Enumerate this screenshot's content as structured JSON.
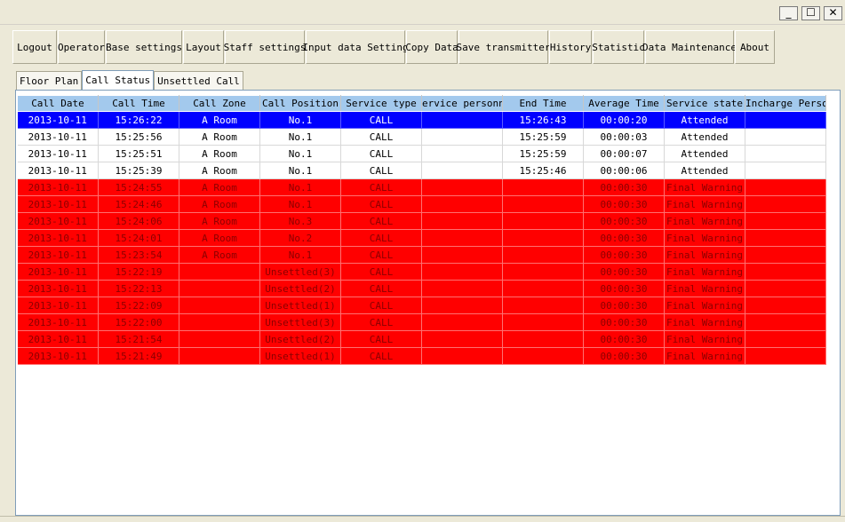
{
  "window": {
    "min_glyph": "_",
    "max_glyph": "☐",
    "close_glyph": "✕"
  },
  "toolbar": [
    {
      "name": "logout-button",
      "label": "Logout"
    },
    {
      "name": "operator-button",
      "label": "Operator"
    },
    {
      "name": "base-settings-button",
      "label": "Base settings"
    },
    {
      "name": "layout-button",
      "label": "Layout"
    },
    {
      "name": "staff-settings-button",
      "label": "Staff settings"
    },
    {
      "name": "input-data-setting-button",
      "label": "Input data Setting"
    },
    {
      "name": "copy-data-button",
      "label": "Copy Data"
    },
    {
      "name": "save-transmitter-button",
      "label": "Save transmitter"
    },
    {
      "name": "history-button",
      "label": "History"
    },
    {
      "name": "statistic-button",
      "label": "Statistic"
    },
    {
      "name": "data-maintenance-button",
      "label": "Data Maintenance"
    },
    {
      "name": "about-button",
      "label": "About"
    }
  ],
  "tabs": [
    {
      "name": "tab-floor-plan",
      "label": "Floor Plan",
      "active": false
    },
    {
      "name": "tab-call-status",
      "label": "Call Status",
      "active": true
    },
    {
      "name": "tab-unsettled-call",
      "label": "Unsettled Call",
      "active": false
    }
  ],
  "table": {
    "columns": [
      "Call Date",
      "Call Time",
      "Call Zone",
      "Call Position",
      "Service type",
      "ervice personne",
      "End Time",
      "Average Time",
      "Service state",
      "Incharge Person"
    ],
    "rows": [
      {
        "state": "selected",
        "cells": [
          "2013-10-11",
          "15:26:22",
          "A Room",
          "No.1",
          "CALL",
          "",
          "15:26:43",
          "00:00:20",
          "Attended",
          ""
        ]
      },
      {
        "state": "normal",
        "cells": [
          "2013-10-11",
          "15:25:56",
          "A Room",
          "No.1",
          "CALL",
          "",
          "15:25:59",
          "00:00:03",
          "Attended",
          ""
        ]
      },
      {
        "state": "normal",
        "cells": [
          "2013-10-11",
          "15:25:51",
          "A Room",
          "No.1",
          "CALL",
          "",
          "15:25:59",
          "00:00:07",
          "Attended",
          ""
        ]
      },
      {
        "state": "normal",
        "cells": [
          "2013-10-11",
          "15:25:39",
          "A Room",
          "No.1",
          "CALL",
          "",
          "15:25:46",
          "00:00:06",
          "Attended",
          ""
        ]
      },
      {
        "state": "warning",
        "cells": [
          "2013-10-11",
          "15:24:55",
          "A Room",
          "No.1",
          "CALL",
          "",
          "",
          "00:00:30",
          "Final Warning",
          ""
        ]
      },
      {
        "state": "warning",
        "cells": [
          "2013-10-11",
          "15:24:46",
          "A Room",
          "No.1",
          "CALL",
          "",
          "",
          "00:00:30",
          "Final Warning",
          ""
        ]
      },
      {
        "state": "warning",
        "cells": [
          "2013-10-11",
          "15:24:06",
          "A Room",
          "No.3",
          "CALL",
          "",
          "",
          "00:00:30",
          "Final Warning",
          ""
        ]
      },
      {
        "state": "warning",
        "cells": [
          "2013-10-11",
          "15:24:01",
          "A Room",
          "No.2",
          "CALL",
          "",
          "",
          "00:00:30",
          "Final Warning",
          ""
        ]
      },
      {
        "state": "warning",
        "cells": [
          "2013-10-11",
          "15:23:54",
          "A Room",
          "No.1",
          "CALL",
          "",
          "",
          "00:00:30",
          "Final Warning",
          ""
        ]
      },
      {
        "state": "warning",
        "cells": [
          "2013-10-11",
          "15:22:19",
          "",
          "Unsettled(3)",
          "CALL",
          "",
          "",
          "00:00:30",
          "Final Warning",
          ""
        ]
      },
      {
        "state": "warning",
        "cells": [
          "2013-10-11",
          "15:22:13",
          "",
          "Unsettled(2)",
          "CALL",
          "",
          "",
          "00:00:30",
          "Final Warning",
          ""
        ]
      },
      {
        "state": "warning",
        "cells": [
          "2013-10-11",
          "15:22:09",
          "",
          "Unsettled(1)",
          "CALL",
          "",
          "",
          "00:00:30",
          "Final Warning",
          ""
        ]
      },
      {
        "state": "warning",
        "cells": [
          "2013-10-11",
          "15:22:00",
          "",
          "Unsettled(3)",
          "CALL",
          "",
          "",
          "00:00:30",
          "Final Warning",
          ""
        ]
      },
      {
        "state": "warning",
        "cells": [
          "2013-10-11",
          "15:21:54",
          "",
          "Unsettled(2)",
          "CALL",
          "",
          "",
          "00:00:30",
          "Final Warning",
          ""
        ]
      },
      {
        "state": "warning",
        "cells": [
          "2013-10-11",
          "15:21:49",
          "",
          "Unsettled(1)",
          "CALL",
          "",
          "",
          "00:00:30",
          "Final Warning",
          ""
        ]
      }
    ]
  }
}
